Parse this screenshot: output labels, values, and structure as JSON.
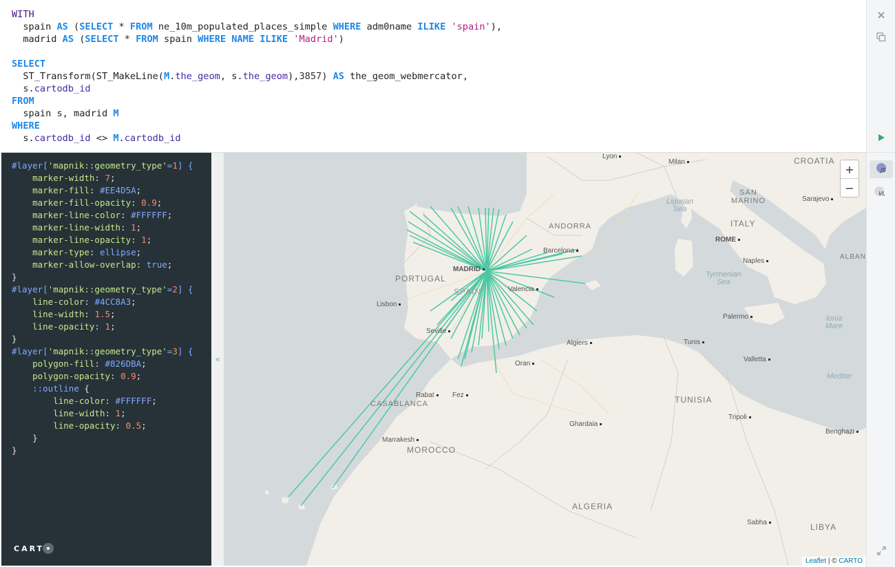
{
  "sql_editor": {
    "lines": [
      [
        {
          "t": "WITH",
          "c": "kw2"
        }
      ],
      [
        {
          "t": "  spain "
        },
        {
          "t": "AS",
          "c": "kw"
        },
        {
          "t": " ("
        },
        {
          "t": "SELECT",
          "c": "kw"
        },
        {
          "t": " * "
        },
        {
          "t": "FROM",
          "c": "kw"
        },
        {
          "t": " ne_10m_populated_places_simple "
        },
        {
          "t": "WHERE",
          "c": "kw"
        },
        {
          "t": " adm0name "
        },
        {
          "t": "ILIKE",
          "c": "kw"
        },
        {
          "t": " "
        },
        {
          "t": "'spain'",
          "c": "str"
        },
        {
          "t": "),"
        }
      ],
      [
        {
          "t": "  madrid "
        },
        {
          "t": "AS",
          "c": "kw"
        },
        {
          "t": " ("
        },
        {
          "t": "SELECT",
          "c": "kw"
        },
        {
          "t": " * "
        },
        {
          "t": "FROM",
          "c": "kw"
        },
        {
          "t": " spain "
        },
        {
          "t": "WHERE",
          "c": "kw"
        },
        {
          "t": " "
        },
        {
          "t": "NAME",
          "c": "kw"
        },
        {
          "t": " "
        },
        {
          "t": "ILIKE",
          "c": "kw"
        },
        {
          "t": " "
        },
        {
          "t": "'Madrid'",
          "c": "str"
        },
        {
          "t": ")"
        }
      ],
      [
        {
          "t": ""
        }
      ],
      [
        {
          "t": "SELECT",
          "c": "kw"
        }
      ],
      [
        {
          "t": "  ST_Transform(ST_MakeLine("
        },
        {
          "t": "M",
          "c": "kw"
        },
        {
          "t": "."
        },
        {
          "t": "the_geom",
          "c": "fld"
        },
        {
          "t": ", s."
        },
        {
          "t": "the_geom",
          "c": "fld"
        },
        {
          "t": "),"
        },
        {
          "t": "3857",
          "c": "num"
        },
        {
          "t": ") "
        },
        {
          "t": "AS",
          "c": "kw"
        },
        {
          "t": " the_geom_webmercator,"
        }
      ],
      [
        {
          "t": "  s."
        },
        {
          "t": "cartodb_id",
          "c": "fld"
        }
      ],
      [
        {
          "t": "FROM",
          "c": "kw"
        }
      ],
      [
        {
          "t": "  spain s, madrid "
        },
        {
          "t": "M",
          "c": "kw"
        }
      ],
      [
        {
          "t": "WHERE",
          "c": "kw"
        }
      ],
      [
        {
          "t": "  s."
        },
        {
          "t": "cartodb_id",
          "c": "fld"
        },
        {
          "t": " <> "
        },
        {
          "t": "M",
          "c": "kw"
        },
        {
          "t": "."
        },
        {
          "t": "cartodb_id",
          "c": "fld"
        }
      ]
    ]
  },
  "cartocss_editor": {
    "lines": [
      [
        {
          "t": "#layer[",
          "c": "sel"
        },
        {
          "t": "'mapnik::geometry_type'",
          "c": "pstr"
        },
        {
          "t": "=",
          "c": "sel"
        },
        {
          "t": "1",
          "c": "pnum"
        },
        {
          "t": "] {",
          "c": "sel"
        }
      ],
      [
        {
          "t": "    "
        },
        {
          "t": "marker-width",
          "c": "prop"
        },
        {
          "t": ": "
        },
        {
          "t": "7",
          "c": "pnum"
        },
        {
          "t": ";"
        }
      ],
      [
        {
          "t": "    "
        },
        {
          "t": "marker-fill",
          "c": "prop"
        },
        {
          "t": ": "
        },
        {
          "t": "#EE4D5A",
          "c": "hex"
        },
        {
          "t": ";"
        }
      ],
      [
        {
          "t": "    "
        },
        {
          "t": "marker-fill-opacity",
          "c": "prop"
        },
        {
          "t": ": "
        },
        {
          "t": "0.9",
          "c": "pnum"
        },
        {
          "t": ";"
        }
      ],
      [
        {
          "t": "    "
        },
        {
          "t": "marker-line-color",
          "c": "prop"
        },
        {
          "t": ": "
        },
        {
          "t": "#FFFFFF",
          "c": "hex"
        },
        {
          "t": ";"
        }
      ],
      [
        {
          "t": "    "
        },
        {
          "t": "marker-line-width",
          "c": "prop"
        },
        {
          "t": ": "
        },
        {
          "t": "1",
          "c": "pnum"
        },
        {
          "t": ";"
        }
      ],
      [
        {
          "t": "    "
        },
        {
          "t": "marker-line-opacity",
          "c": "prop"
        },
        {
          "t": ": "
        },
        {
          "t": "1",
          "c": "pnum"
        },
        {
          "t": ";"
        }
      ],
      [
        {
          "t": "    "
        },
        {
          "t": "marker-type",
          "c": "prop"
        },
        {
          "t": ": "
        },
        {
          "t": "ellipse",
          "c": "ident"
        },
        {
          "t": ";"
        }
      ],
      [
        {
          "t": "    "
        },
        {
          "t": "marker-allow-overlap",
          "c": "prop"
        },
        {
          "t": ": "
        },
        {
          "t": "true",
          "c": "ident"
        },
        {
          "t": ";"
        }
      ],
      [
        {
          "t": "}"
        }
      ],
      [
        {
          "t": "#layer[",
          "c": "sel"
        },
        {
          "t": "'mapnik::geometry_type'",
          "c": "pstr"
        },
        {
          "t": "=",
          "c": "sel"
        },
        {
          "t": "2",
          "c": "pnum"
        },
        {
          "t": "] {",
          "c": "sel"
        }
      ],
      [
        {
          "t": "    "
        },
        {
          "t": "line-color",
          "c": "prop"
        },
        {
          "t": ": "
        },
        {
          "t": "#4CC8A3",
          "c": "hex"
        },
        {
          "t": ";"
        }
      ],
      [
        {
          "t": "    "
        },
        {
          "t": "line-width",
          "c": "prop"
        },
        {
          "t": ": "
        },
        {
          "t": "1.5",
          "c": "pnum"
        },
        {
          "t": ";"
        }
      ],
      [
        {
          "t": "    "
        },
        {
          "t": "line-opacity",
          "c": "prop"
        },
        {
          "t": ": "
        },
        {
          "t": "1",
          "c": "pnum"
        },
        {
          "t": ";"
        }
      ],
      [
        {
          "t": "}"
        }
      ],
      [
        {
          "t": "#layer[",
          "c": "sel"
        },
        {
          "t": "'mapnik::geometry_type'",
          "c": "pstr"
        },
        {
          "t": "=",
          "c": "sel"
        },
        {
          "t": "3",
          "c": "pnum"
        },
        {
          "t": "] {",
          "c": "sel"
        }
      ],
      [
        {
          "t": "    "
        },
        {
          "t": "polygon-fill",
          "c": "prop"
        },
        {
          "t": ": "
        },
        {
          "t": "#826DBA",
          "c": "hex"
        },
        {
          "t": ";"
        }
      ],
      [
        {
          "t": "    "
        },
        {
          "t": "polygon-opacity",
          "c": "prop"
        },
        {
          "t": ": "
        },
        {
          "t": "0.9",
          "c": "pnum"
        },
        {
          "t": ";"
        }
      ],
      [
        {
          "t": "    "
        },
        {
          "t": "::outline",
          "c": "ident"
        },
        {
          "t": " {"
        }
      ],
      [
        {
          "t": "        "
        },
        {
          "t": "line-color",
          "c": "prop"
        },
        {
          "t": ": "
        },
        {
          "t": "#FFFFFF",
          "c": "hex"
        },
        {
          "t": ";"
        }
      ],
      [
        {
          "t": "        "
        },
        {
          "t": "line-width",
          "c": "prop"
        },
        {
          "t": ": "
        },
        {
          "t": "1",
          "c": "pnum"
        },
        {
          "t": ";"
        }
      ],
      [
        {
          "t": "        "
        },
        {
          "t": "line-opacity",
          "c": "prop"
        },
        {
          "t": ": "
        },
        {
          "t": "0.5",
          "c": "pnum"
        },
        {
          "t": ";"
        }
      ],
      [
        {
          "t": "    }"
        }
      ],
      [
        {
          "t": "}"
        }
      ]
    ]
  },
  "brand": {
    "logo_text": "CART"
  },
  "sidebar": {
    "close_icon": "close-icon",
    "copy_icon": "copy-icon",
    "run_icon": "play-icon",
    "js_label": "JS",
    "vl_label": "VL",
    "expand_icon": "expand-icon",
    "collapse_glyph": "«"
  },
  "map": {
    "zoom_in": "+",
    "zoom_out": "−",
    "attribution_leaflet": "Leaflet",
    "attribution_sep": " | © ",
    "attribution_carto": "CARTO",
    "line_color": "#4CC8A3",
    "water_color": "#d4dadc",
    "land_color": "#f2efe9",
    "labels": {
      "lyon": "Lyon",
      "milan": "Milan",
      "croatia": "CROATIA",
      "san_marino": "SAN\nMARINO",
      "sarajevo": "Sarajevo",
      "andorra": "ANDORRA",
      "ligurian": "Ligurian\nSea",
      "italy": "ITALY",
      "rome": "ROME",
      "barcelona": "Barcelona",
      "naples": "Naples",
      "alban": "ALBAN",
      "portugal": "PORTUGAL",
      "madrid": "MADRID",
      "spain": "SPAIN",
      "tyrrhenian": "Tyrrhenian\nSea",
      "lisbon": "Lisbon",
      "valencia": "Valencia",
      "palermo": "Palermo",
      "ionian": "Ionia\nMare",
      "seville": "Seville",
      "algiers": "Algiers",
      "tunis": "Tunis",
      "valletta": "Valletta",
      "oran": "Oran",
      "mediter": "Mediter",
      "rabat": "Rabat",
      "fez": "Fez",
      "casablanca": "CASABLANCA",
      "tunisia": "TUNISIA",
      "ghardaia": "Ghardaia",
      "tripoli": "Tripoli",
      "marrakesh": "Marrakesh",
      "morocco": "MOROCCO",
      "benghazi": "Benghazi",
      "algeria": "ALGERIA",
      "sabha": "Sabha",
      "libya": "LIBYA"
    }
  }
}
